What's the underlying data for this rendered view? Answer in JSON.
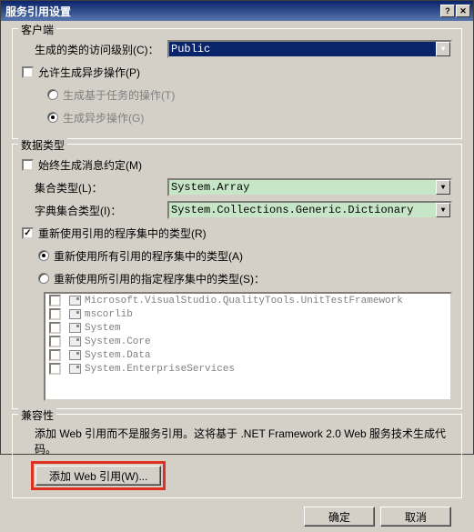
{
  "title": "服务引用设置",
  "groups": {
    "client": {
      "legend": "客户端",
      "access_level_label": "生成的类的访问级别(C)：",
      "access_level_value": "Public",
      "allow_async": "允许生成异步操作(P)",
      "task_based": "生成基于任务的操作(T)",
      "async_ops": "生成异步操作(G)"
    },
    "data": {
      "legend": "数据类型",
      "always_msgcontract": "始终生成消息约定(M)",
      "collection_label": "集合类型(L)：",
      "collection_value": "System.Array",
      "dict_label": "字典集合类型(I)：",
      "dict_value": "System.Collections.Generic.Dictionary",
      "reuse_types": "重新使用引用的程序集中的类型(R)",
      "reuse_all": "重新使用所有引用的程序集中的类型(A)",
      "reuse_specified": "重新使用所引用的指定程序集中的类型(S)：",
      "assemblies": [
        "Microsoft.VisualStudio.QualityTools.UnitTestFramework",
        "mscorlib",
        "System",
        "System.Core",
        "System.Data",
        "System.EnterpriseServices"
      ]
    },
    "compat": {
      "legend": "兼容性",
      "text": "添加 Web 引用而不是服务引用。这将基于 .NET Framework 2.0 Web 服务技术生成代码。",
      "add_web_ref": "添加 Web 引用(W)..."
    }
  },
  "buttons": {
    "ok": "确定",
    "cancel": "取消"
  }
}
